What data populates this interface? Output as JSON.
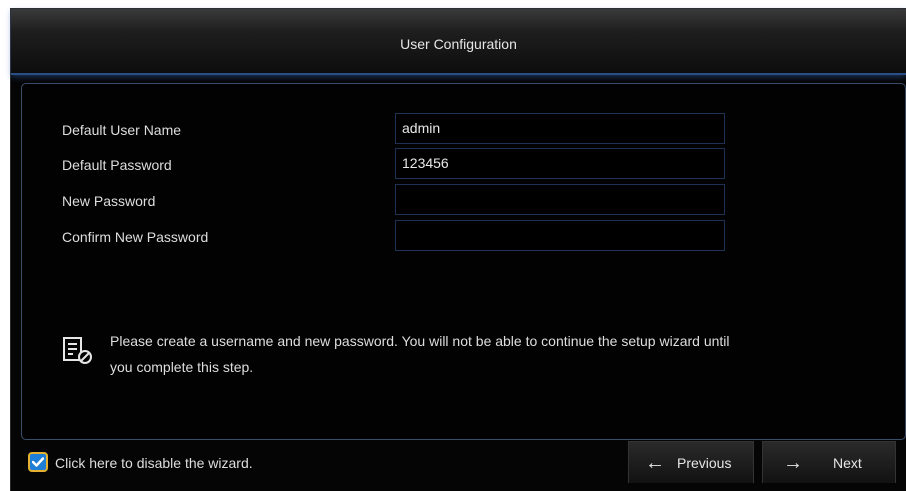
{
  "window": {
    "title": "User Configuration"
  },
  "form": {
    "fields": [
      {
        "label": "Default User Name",
        "value": "admin"
      },
      {
        "label": "Default Password",
        "value": "123456"
      },
      {
        "label": "New Password",
        "value": ""
      },
      {
        "label": "Confirm New Password",
        "value": ""
      }
    ]
  },
  "note": {
    "line1": "Please create a username and new password. You will not be able to continue the setup wizard until",
    "line2": "you complete this step.",
    "icon": "note-icon"
  },
  "footer": {
    "disable_wizard_label": "Click here to disable the wizard.",
    "disable_wizard_checked": true,
    "previous_label": "Previous",
    "next_label": "Next",
    "previous_arrow": "←",
    "next_arrow": "→"
  },
  "colors": {
    "accent_blue": "#2a4f86",
    "checkbox_fill": "#1f7fd6",
    "checkbox_border": "#e6b030"
  }
}
